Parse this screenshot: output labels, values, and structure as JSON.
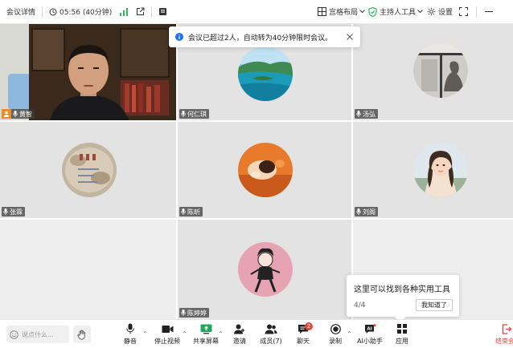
{
  "topbar": {
    "meeting_details": "会议详情",
    "timer": "05:56 (40分钟)",
    "layout": "宫格布局",
    "host_tools": "主持人工具",
    "settings": "设置"
  },
  "toast": {
    "message": "会议已超过2人，自动转为40分钟限时会议。"
  },
  "participants": [
    {
      "name": "黄智",
      "role": "host"
    },
    {
      "name": "何仁琪"
    },
    {
      "name": "汤弘"
    },
    {
      "name": "张霖"
    },
    {
      "name": "陈昕"
    },
    {
      "name": "刘阁"
    },
    {
      "name": "陈婷婷"
    }
  ],
  "tooltip": {
    "title": "这里可以找到各种实用工具",
    "page": "4/4",
    "button": "我知道了"
  },
  "bottombar": {
    "chat_placeholder": "说点什么...",
    "mute": "静音",
    "stop_video": "停止视频",
    "share_screen": "共享屏幕",
    "invite": "邀请",
    "members": "成员(7)",
    "chat": "聊天",
    "chat_badge": "2",
    "record": "录制",
    "ai_assistant": "AI小助手",
    "apps": "应用",
    "end": "结束会"
  },
  "colors": {
    "accent": "#1e6fff",
    "signal": "#2bbd5a",
    "end": "#e8443a",
    "host_badge": "#f08a24"
  }
}
